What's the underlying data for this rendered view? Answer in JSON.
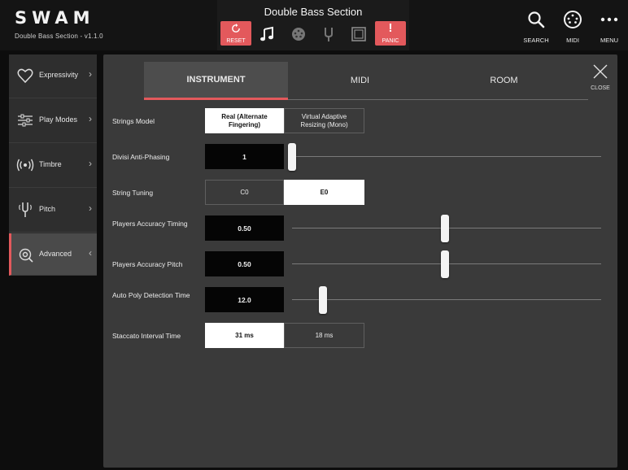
{
  "brand": {
    "logo": "SWAM",
    "subtitle": "Double Bass Section - v1.1.0"
  },
  "toolbar": {
    "preset_title": "Double Bass Section",
    "reset_label": "RESET",
    "panic_label": "PANIC",
    "panic_glyph": "!",
    "icons": [
      "music-note-icon",
      "midi-icon",
      "tuning-fork-icon",
      "frame-icon"
    ]
  },
  "right_tools": [
    {
      "label": "SEARCH",
      "icon": "search-icon"
    },
    {
      "label": "MIDI",
      "icon": "midi-icon"
    },
    {
      "label": "MENU",
      "icon": "menu-icon"
    }
  ],
  "sidebar": {
    "items": [
      {
        "label": "Expressivity",
        "icon": "heart-icon"
      },
      {
        "label": "Play Modes",
        "icon": "sliders-icon"
      },
      {
        "label": "Timbre",
        "icon": "signal-icon"
      },
      {
        "label": "Pitch",
        "icon": "tuning-fork-icon"
      },
      {
        "label": "Advanced",
        "icon": "advanced-icon",
        "active": true
      }
    ]
  },
  "tabs": [
    {
      "label": "INSTRUMENT",
      "active": true
    },
    {
      "label": "MIDI"
    },
    {
      "label": "ROOM"
    }
  ],
  "close_label": "CLOSE",
  "settings": {
    "strings_model": {
      "label": "Strings Model",
      "options": [
        "Real (Alternate Fingering)",
        "Virtual Adaptive Resizing (Mono)"
      ],
      "selected": "Real (Alternate Fingering)"
    },
    "divisi": {
      "label": "Divisi Anti-Phasing",
      "value": "1",
      "level": 0.0
    },
    "string_tuning": {
      "label": "String Tuning",
      "options": [
        "C0",
        "E0"
      ],
      "selected": "E0"
    },
    "acc_timing": {
      "label": "Players Accuracy Timing",
      "value": "0.50",
      "level": 0.5
    },
    "acc_pitch": {
      "label": "Players Accuracy Pitch",
      "value": "0.50",
      "level": 0.5
    },
    "poly_time": {
      "label": "Auto Poly Detection Time",
      "value": "12.0",
      "level": 0.1
    },
    "staccato": {
      "label": "Staccato Interval Time",
      "options": [
        "31 ms",
        "18 ms"
      ],
      "selected": "31 ms"
    }
  },
  "colors": {
    "accent": "#e3595c",
    "panel": "#3a3a3a",
    "sidebar": "#2e2e2e",
    "background": "#0d0d0d"
  }
}
